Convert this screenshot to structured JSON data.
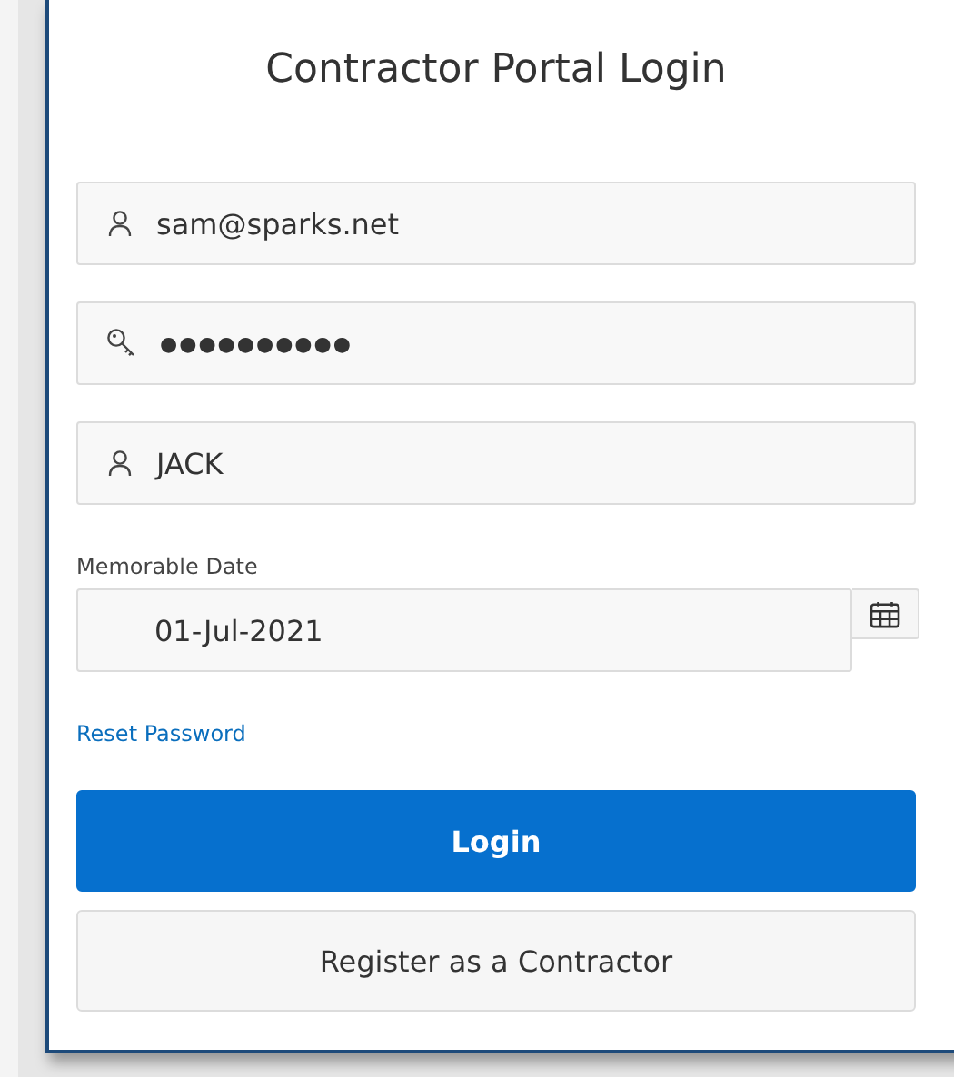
{
  "title": "Contractor Portal Login",
  "fields": [
    {
      "kind": "user",
      "value": "sam@sparks.net"
    },
    {
      "kind": "key",
      "value": "●●●●●●●●●●"
    },
    {
      "kind": "user",
      "value": "JACK"
    }
  ],
  "date": {
    "label": "Memorable Date",
    "value": "01-Jul-2021"
  },
  "reset_link": "Reset Password",
  "buttons": [
    {
      "kind": "primary",
      "label": "Login"
    },
    {
      "kind": "secondary",
      "label": "Register as a Contractor"
    }
  ]
}
